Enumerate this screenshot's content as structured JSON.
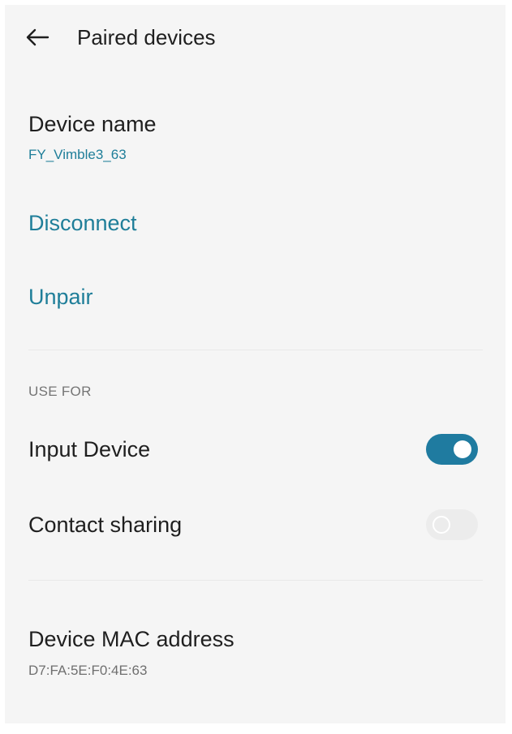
{
  "header": {
    "back_icon": "arrow-left-icon",
    "title": "Paired devices"
  },
  "device_name": {
    "title": "Device name",
    "value": "FY_Vimble3_63"
  },
  "actions": {
    "disconnect": "Disconnect",
    "unpair": "Unpair"
  },
  "use_for": {
    "section_title": "USE FOR",
    "items": [
      {
        "label": "Input Device",
        "enabled": true
      },
      {
        "label": "Contact sharing",
        "enabled": false
      }
    ]
  },
  "mac": {
    "title": "Device MAC address",
    "value": "D7:FA:5E:F0:4E:63"
  },
  "colors": {
    "accent": "#1f7e99",
    "toggle_on": "#1f7ba0",
    "toggle_off": "#ececec",
    "background": "#f5f5f5"
  }
}
